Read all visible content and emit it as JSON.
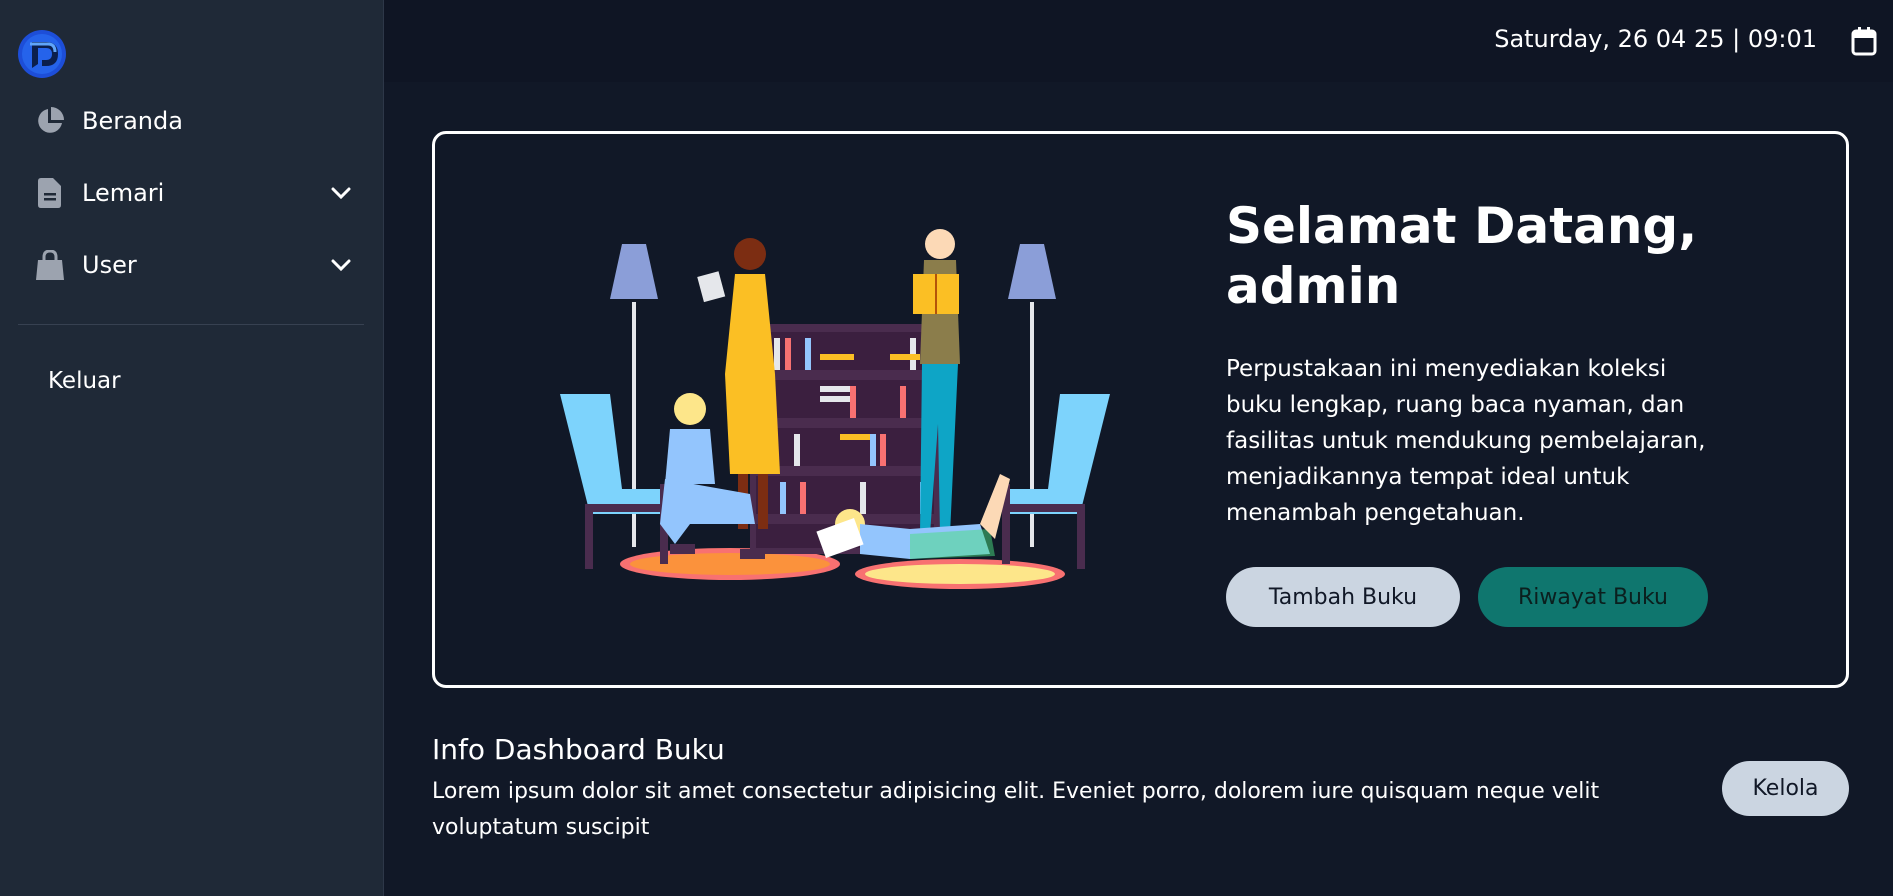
{
  "sidebar": {
    "logo_icon": "app-logo-icon",
    "items": [
      {
        "label": "Beranda",
        "icon": "pie-chart-icon"
      },
      {
        "label": "Lemari",
        "icon": "document-icon",
        "has_submenu": true
      },
      {
        "label": "User",
        "icon": "bag-icon",
        "has_submenu": true
      }
    ],
    "logout_label": "Keluar"
  },
  "header": {
    "datetime": "Saturday, 26 04 25 | 09:01",
    "calendar_icon": "calendar-icon"
  },
  "hero": {
    "title_line1": "Selamat Datang,",
    "title_line2": "admin",
    "description": "Perpustakaan ini menyediakan koleksi buku lengkap, ruang baca nyaman, dan fasilitas untuk mendukung pembelajaran, menjadikannya tempat ideal untuk menambah pengetahuan.",
    "primary_button": "Tambah Buku",
    "secondary_button": "Riwayat Buku",
    "illustration": "library-reading-illustration"
  },
  "info": {
    "title": "Info Dashboard Buku",
    "description": "Lorem ipsum dolor sit amet consectetur adipisicing elit. Eveniet porro, dolorem iure quisquam neque velit voluptatum suscipit",
    "button": "Kelola"
  },
  "colors": {
    "background": "#111827",
    "sidebar": "#1f2937",
    "accent_teal": "#0f766e",
    "button_light": "#cbd5e1",
    "logo_blue": "#2563eb"
  }
}
